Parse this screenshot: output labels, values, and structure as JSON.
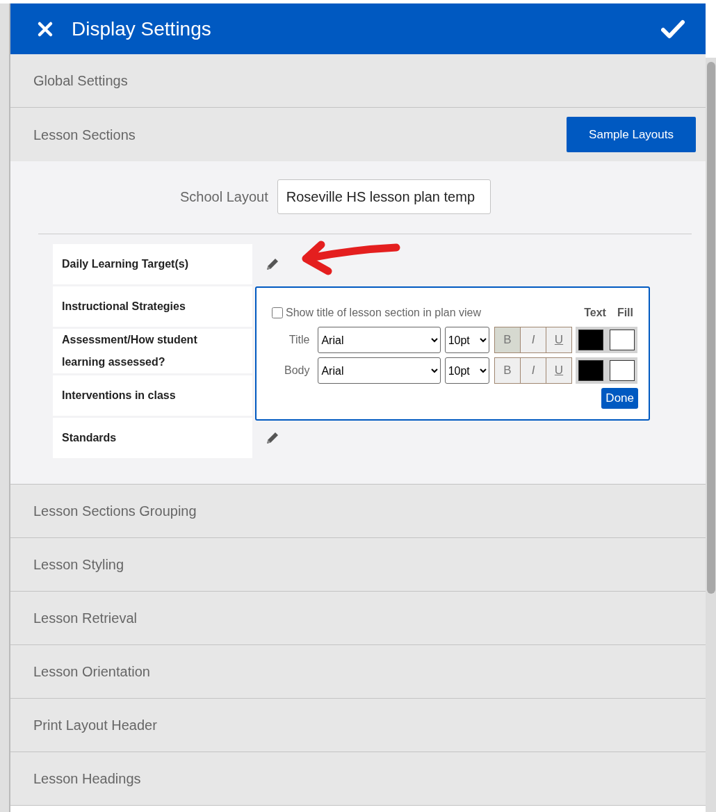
{
  "dialog": {
    "title": "Display Settings"
  },
  "accordion": [
    {
      "label": "Global Settings",
      "expanded": false
    },
    {
      "label": "Lesson Sections",
      "expanded": true,
      "button": "Sample Layouts"
    },
    {
      "label": "Lesson Sections Grouping",
      "expanded": false
    },
    {
      "label": "Lesson Styling",
      "expanded": false
    },
    {
      "label": "Lesson Retrieval",
      "expanded": false
    },
    {
      "label": "Lesson Orientation",
      "expanded": false
    },
    {
      "label": "Print Layout Header",
      "expanded": false
    },
    {
      "label": "Lesson Headings",
      "expanded": false
    }
  ],
  "school_layout": {
    "label": "School Layout",
    "value": "Roseville HS lesson plan temp"
  },
  "sections": [
    {
      "title": "Daily Learning Target(s)",
      "edit_icon": true
    },
    {
      "title": "Instructional Strategies",
      "edit_icon": false
    },
    {
      "title": "Assessment/How student learning assessed?",
      "edit_icon": false
    },
    {
      "title": "Interventions in class",
      "edit_icon": false
    },
    {
      "title": "Standards",
      "edit_icon": true
    }
  ],
  "style_popover": {
    "checkbox_label": "Show title of lesson section in plan view",
    "checked": false,
    "headers": [
      "Text",
      "Fill"
    ],
    "rows": [
      {
        "label": "Title",
        "font": "Arial",
        "size": "10pt",
        "styles": [
          {
            "label": "B",
            "kind": "bold",
            "selected": true
          },
          {
            "label": "I",
            "kind": "italic",
            "selected": false
          },
          {
            "label": "U",
            "kind": "underline",
            "selected": false
          }
        ],
        "swatches": [
          {
            "color": "#000000"
          },
          {
            "color": "#ffffff"
          }
        ]
      },
      {
        "label": "Body",
        "font": "Arial",
        "size": "10pt",
        "styles": [
          {
            "label": "B",
            "kind": "bold",
            "selected": false
          },
          {
            "label": "I",
            "kind": "italic",
            "selected": false
          },
          {
            "label": "U",
            "kind": "underline",
            "selected": false
          }
        ],
        "swatches": [
          {
            "color": "#000000"
          },
          {
            "color": "#ffffff"
          }
        ]
      }
    ],
    "done": "Done"
  }
}
